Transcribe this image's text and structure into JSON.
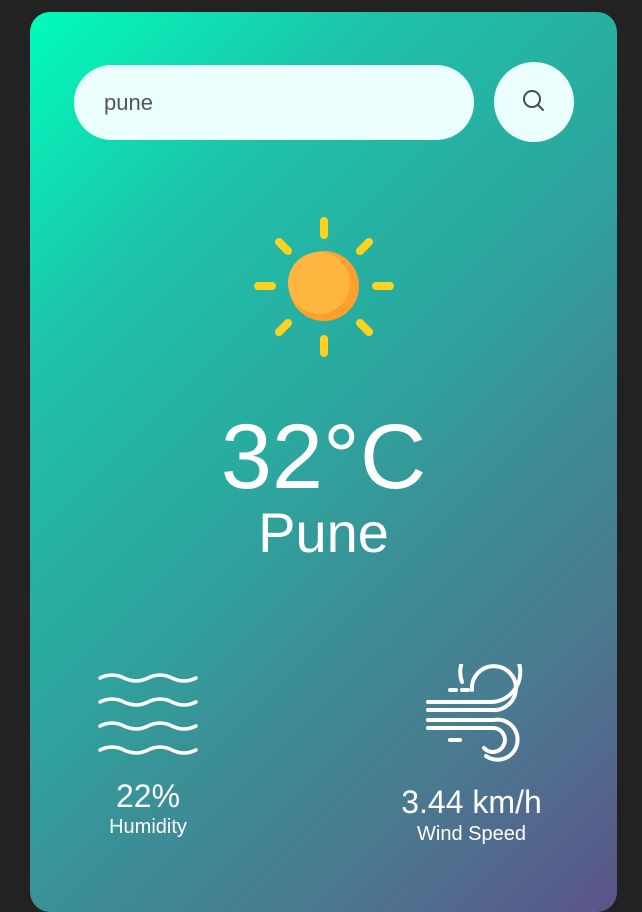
{
  "search": {
    "value": "pune",
    "button_icon": "search-icon"
  },
  "weather": {
    "icon": "sun-icon",
    "temperature": "32°C",
    "city": "Pune"
  },
  "details": {
    "humidity": {
      "icon": "humidity-waves-icon",
      "value": "22%",
      "label": "Humidity"
    },
    "wind": {
      "icon": "wind-icon",
      "value": "3.44 km/h",
      "label": "Wind Speed"
    }
  },
  "colors": {
    "gradient_start": "#00fcbd",
    "gradient_end": "#5c5489",
    "input_background": "#ebfffc",
    "sun_core": "#ffb03b",
    "sun_rays": "#ffd21f",
    "text": "#ffffff"
  }
}
